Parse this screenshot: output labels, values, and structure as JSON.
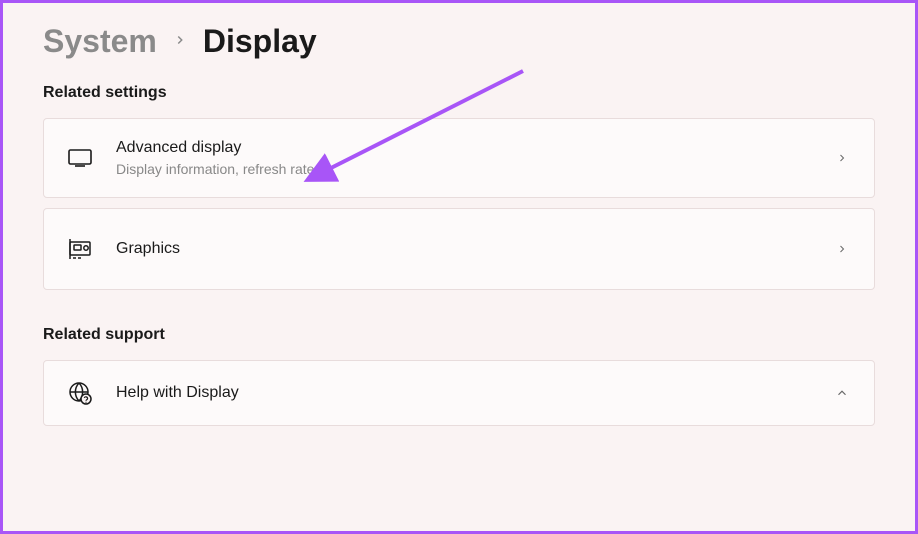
{
  "breadcrumb": {
    "parent": "System",
    "current": "Display"
  },
  "sections": {
    "settings": {
      "heading": "Related settings",
      "items": [
        {
          "icon": "monitor-icon",
          "title": "Advanced display",
          "subtitle": "Display information, refresh rate"
        },
        {
          "icon": "gpu-icon",
          "title": "Graphics",
          "subtitle": ""
        }
      ]
    },
    "support": {
      "heading": "Related support",
      "items": [
        {
          "icon": "help-globe-icon",
          "title": "Help with Display"
        }
      ]
    }
  },
  "annotation": {
    "color": "#a855f7"
  }
}
